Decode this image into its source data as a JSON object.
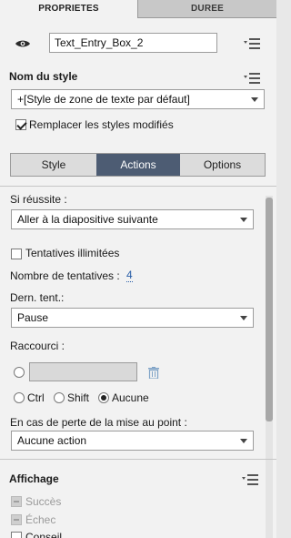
{
  "tabs": {
    "properties": "PROPRIETES",
    "duration": "DUREE"
  },
  "object": {
    "name": "Text_Entry_Box_2"
  },
  "style": {
    "heading": "Nom du style",
    "selected": "+[Style de zone de texte par défaut]",
    "replace_label": "Remplacer les styles modifiés",
    "replace_checked": true
  },
  "subtabs": [
    "Style",
    "Actions",
    "Options"
  ],
  "active_subtab": "Actions",
  "actions": {
    "success_label": "Si réussite :",
    "success_value": "Aller à la diapositive suivante",
    "unlimited_label": "Tentatives illimitées",
    "unlimited_checked": false,
    "attempts_label": "Nombre de tentatives :",
    "attempts_value": "4",
    "last_label": "Dern. tent.:",
    "last_value": "Pause",
    "shortcut_label": "Raccourci :",
    "shortcut_value": "",
    "modifiers": {
      "ctrl": "Ctrl",
      "shift": "Shift",
      "none": "Aucune"
    },
    "modifier_selected": "Aucune",
    "focus_lost_label": "En cas de perte de la mise au point :",
    "focus_lost_value": "Aucune action"
  },
  "display": {
    "heading": "Affichage",
    "success": "Succès",
    "failure": "Échec",
    "hint": "Conseil"
  },
  "colors": {
    "active_subtab": "#4d5c73",
    "panel_bg": "#f2f2f2",
    "link": "#2a5fa8"
  },
  "icons": [
    "eye-icon",
    "menu-icon",
    "trash-icon",
    "chevron-down-icon"
  ]
}
